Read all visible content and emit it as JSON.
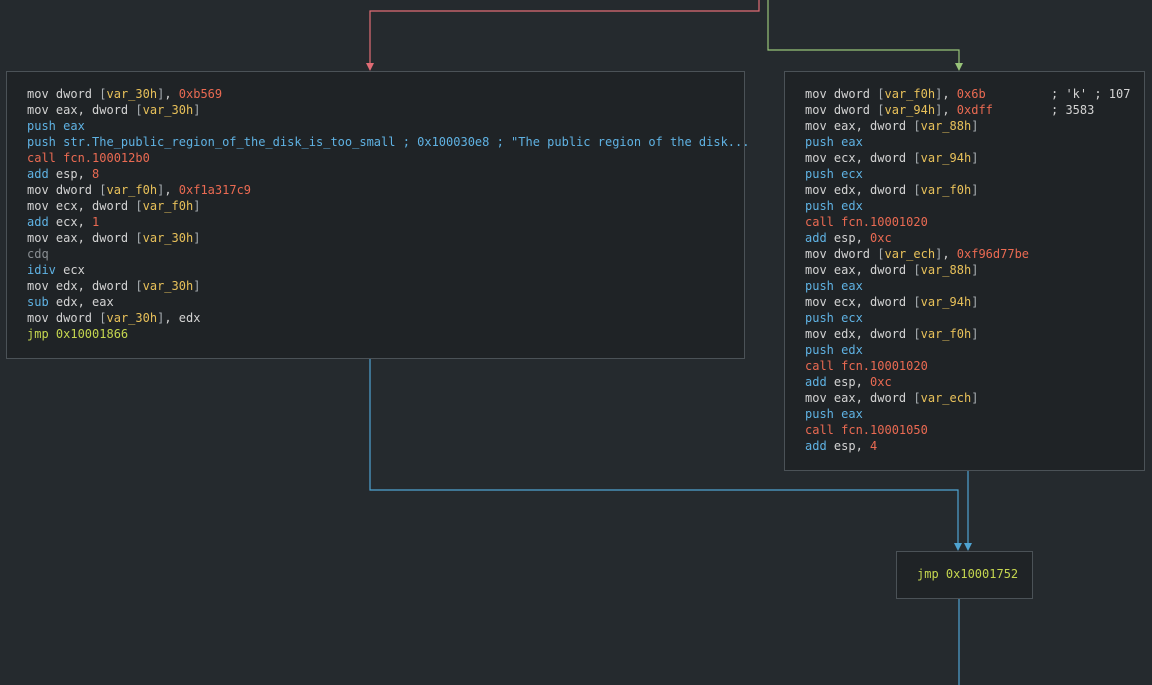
{
  "colors": {
    "background": "#252a2e",
    "node_bg": "#1f2326",
    "node_border": "#4b5257",
    "edge_false": "#e06c75",
    "edge_true": "#98c379",
    "edge_uncond": "#4fa3d1",
    "mnemonic_mov": "#d3d3d3",
    "mnemonic_push": "#5fb2e3",
    "mnemonic_call": "#ea6a52",
    "mnemonic_jmp": "#c5d64f",
    "immediate": "#ea6a52",
    "variable": "#e8c15a"
  },
  "blocks": {
    "left": {
      "lines": [
        {
          "op": "mov dword ",
          "var": "var_30h",
          "rest": "], ",
          "num": "0xb569"
        },
        {
          "op": "mov eax, dword ",
          "var": "var_30h",
          "rest": "]",
          "num": ""
        },
        {
          "op": "push eax"
        },
        {
          "op": "push str.The_public_region_of_the_disk_is_too_small ; 0x100030e8 ; \"The public region of the disk..."
        },
        {
          "op": "call fcn.100012b0"
        },
        {
          "op": "add esp, ",
          "num": "8"
        },
        {
          "op": "mov dword ",
          "var": "var_f0h",
          "rest": "], ",
          "num": "0xf1a317c9"
        },
        {
          "op": "mov ecx, dword ",
          "var": "var_f0h",
          "rest": "]",
          "num": ""
        },
        {
          "op": "add ecx, ",
          "num": "1"
        },
        {
          "op": "mov eax, dword ",
          "var": "var_30h",
          "rest": "]",
          "num": ""
        },
        {
          "op": "cdq"
        },
        {
          "op": "idiv ecx"
        },
        {
          "op": "mov edx, dword ",
          "var": "var_30h",
          "rest": "]",
          "num": ""
        },
        {
          "op": "sub edx, eax"
        },
        {
          "op": "mov dword ",
          "var": "var_30h",
          "rest": "], edx",
          "num": ""
        },
        {
          "op": "jmp 0x10001866"
        }
      ]
    },
    "right": {
      "lines": [
        {
          "op": "mov dword ",
          "var": "var_f0h",
          "rest": "], ",
          "num": "0x6b",
          "comment": "; 'k' ; 107"
        },
        {
          "op": "mov dword ",
          "var": "var_94h",
          "rest": "], ",
          "num": "0xdff",
          "comment": "; 3583"
        },
        {
          "op": "mov eax, dword ",
          "var": "var_88h",
          "rest": "]",
          "num": ""
        },
        {
          "op": "push eax"
        },
        {
          "op": "mov ecx, dword ",
          "var": "var_94h",
          "rest": "]",
          "num": ""
        },
        {
          "op": "push ecx"
        },
        {
          "op": "mov edx, dword ",
          "var": "var_f0h",
          "rest": "]",
          "num": ""
        },
        {
          "op": "push edx"
        },
        {
          "op": "call fcn.10001020"
        },
        {
          "op": "add esp, ",
          "num": "0xc"
        },
        {
          "op": "mov dword ",
          "var": "var_ech",
          "rest": "], ",
          "num": "0xf96d77be"
        },
        {
          "op": "mov eax, dword ",
          "var": "var_88h",
          "rest": "]",
          "num": ""
        },
        {
          "op": "push eax"
        },
        {
          "op": "mov ecx, dword ",
          "var": "var_94h",
          "rest": "]",
          "num": ""
        },
        {
          "op": "push ecx"
        },
        {
          "op": "mov edx, dword ",
          "var": "var_f0h",
          "rest": "]",
          "num": ""
        },
        {
          "op": "push edx"
        },
        {
          "op": "call fcn.10001020"
        },
        {
          "op": "add esp, ",
          "num": "0xc"
        },
        {
          "op": "mov eax, dword ",
          "var": "var_ech",
          "rest": "]",
          "num": ""
        },
        {
          "op": "push eax"
        },
        {
          "op": "call fcn.10001050"
        },
        {
          "op": "add esp, ",
          "num": "4"
        }
      ]
    },
    "bottom": {
      "lines": [
        {
          "op": "jmp 0x10001752"
        }
      ]
    }
  }
}
